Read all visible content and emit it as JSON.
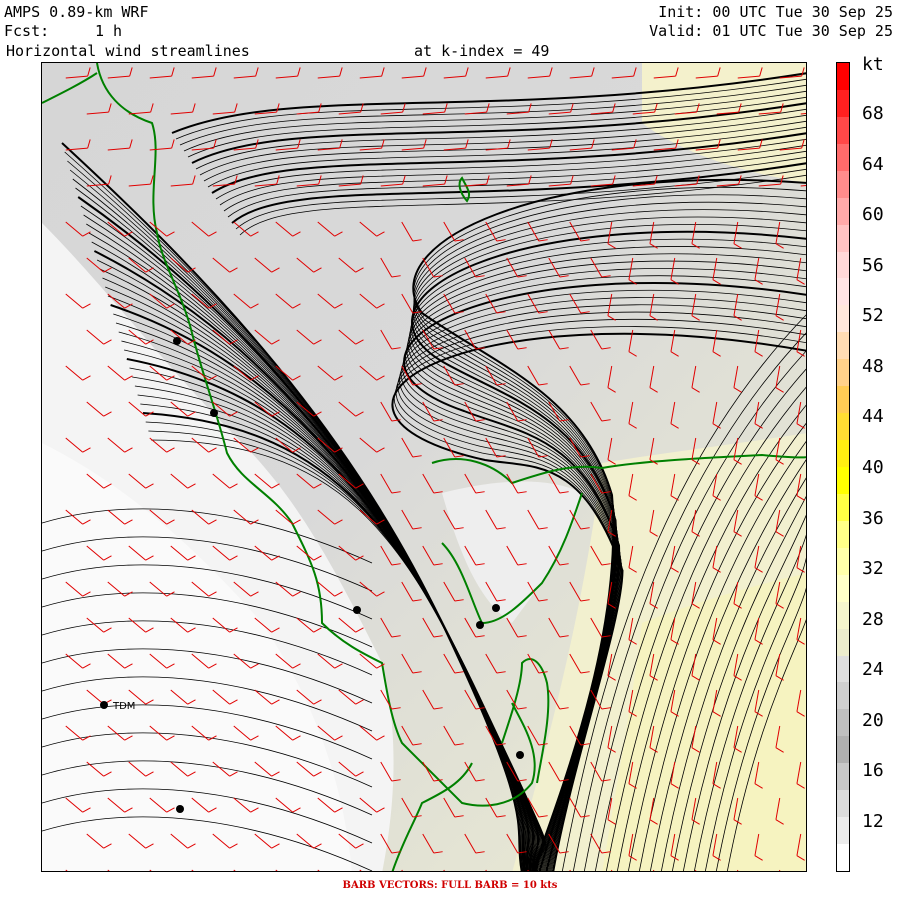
{
  "header": {
    "model": "AMPS 0.89-km WRF",
    "fcst_label": "Fcst:",
    "fcst_value": "1 h",
    "field": "Horizontal wind streamlines",
    "level": "at k-index = 49",
    "init": "Init: 00 UTC Tue 30 Sep 25",
    "valid": "Valid: 01 UTC Tue 30 Sep 25"
  },
  "colorbar": {
    "unit": "kt",
    "ticks": [
      "68",
      "64",
      "60",
      "56",
      "52",
      "48",
      "44",
      "40",
      "36",
      "32",
      "28",
      "24",
      "20",
      "16",
      "12"
    ],
    "colors": [
      "#ff0000",
      "#ff2020",
      "#ff4848",
      "#ff6b6b",
      "#ff8c8c",
      "#ffaaaa",
      "#ffc4c4",
      "#ffd8d8",
      "#ffe4e4",
      "#ffe8dc",
      "#ffdcb4",
      "#ffd18a",
      "#ffcc55",
      "#ffdd33",
      "#ffee11",
      "#ffff00",
      "#ffff44",
      "#ffff88",
      "#ffffaa",
      "#ffffc8",
      "#f5f5cd",
      "#ececcd",
      "#dedede",
      "#cfcfcf",
      "#bfbfbf",
      "#b0b0b0",
      "#c8c8c8",
      "#dcdcdc",
      "#ececec",
      "#ffffff"
    ]
  },
  "map": {
    "stations": [
      {
        "label": ""
      },
      {
        "label": ""
      },
      {
        "label": ""
      },
      {
        "label": ""
      },
      {
        "label": ""
      },
      {
        "label": "TDM"
      },
      {
        "label": ""
      },
      {
        "label": ""
      }
    ],
    "colors": {
      "coast": "#008000",
      "barbs": "#e00000",
      "streamlines": "#000000"
    }
  },
  "footer": "BARB VECTORS:  FULL BARB = 10 kts"
}
